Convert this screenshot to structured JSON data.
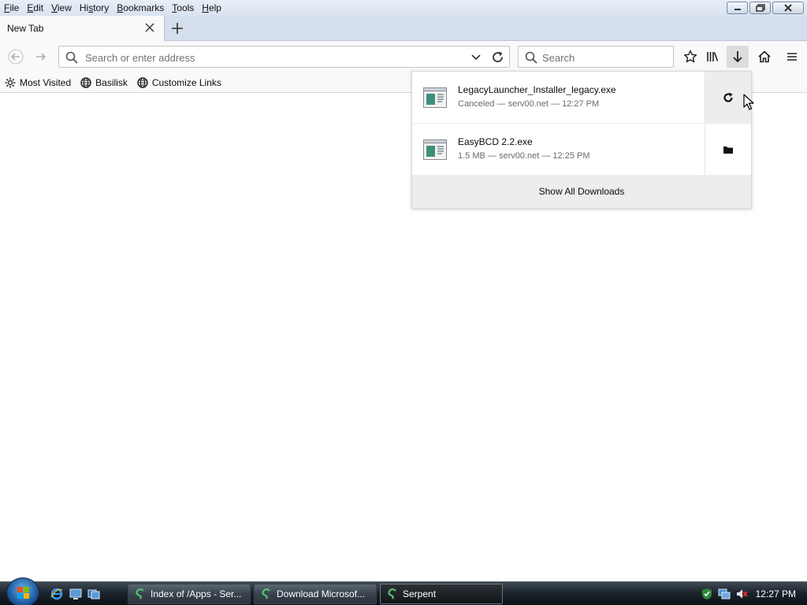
{
  "menubar": {
    "items": [
      {
        "label": "File",
        "accel": "F"
      },
      {
        "label": "Edit",
        "accel": "E"
      },
      {
        "label": "View",
        "accel": "V"
      },
      {
        "label": "History",
        "accel": "s"
      },
      {
        "label": "Bookmarks",
        "accel": "B"
      },
      {
        "label": "Tools",
        "accel": "T"
      },
      {
        "label": "Help",
        "accel": "H"
      }
    ]
  },
  "tabs": [
    {
      "title": "New Tab",
      "active": true
    }
  ],
  "navbar": {
    "url_placeholder": "Search or enter address",
    "search_placeholder": "Search"
  },
  "bookmarks": [
    {
      "label": "Most Visited",
      "icon": "gear-icon"
    },
    {
      "label": "Basilisk",
      "icon": "globe-icon"
    },
    {
      "label": "Customize Links",
      "icon": "globe-icon"
    }
  ],
  "downloads": {
    "items": [
      {
        "name": "LegacyLauncher_Installer_legacy.exe",
        "meta": "Canceled — serv00.net — 12:27 PM",
        "action": "retry-icon"
      },
      {
        "name": "EasyBCD 2.2.exe",
        "meta": "1.5 MB — serv00.net — 12:25 PM",
        "action": "folder-icon"
      }
    ],
    "footer": "Show All Downloads"
  },
  "taskbar": {
    "windows": [
      {
        "label": "Index of /Apps - Ser...",
        "active": false
      },
      {
        "label": "Download Microsof...",
        "active": false
      },
      {
        "label": "Serpent",
        "active": true
      }
    ],
    "clock": "12:27 PM"
  },
  "colors": {
    "chrome": "#f9f9fa",
    "tabstrip": "#d4deec",
    "taskbar": "#1a222a"
  }
}
